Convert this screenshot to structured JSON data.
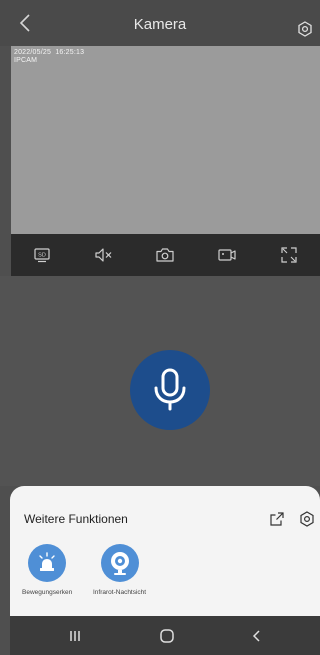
{
  "header": {
    "title": "Kamera",
    "back_icon": "chevron-left-icon",
    "settings_icon": "gear-icon"
  },
  "video": {
    "timestamp": "2022/05/25  16:25:13",
    "camera_name": "IPCAM"
  },
  "toolbar": {
    "items": [
      {
        "icon": "sd-quality-icon",
        "label": "SD"
      },
      {
        "icon": "mute-icon"
      },
      {
        "icon": "camera-snapshot-icon"
      },
      {
        "icon": "video-record-icon"
      },
      {
        "icon": "fullscreen-icon"
      }
    ]
  },
  "talk": {
    "icon": "microphone-icon",
    "color": "#1d4d8c"
  },
  "more_functions": {
    "title": "Weitere Funktionen",
    "open_icon": "external-link-icon",
    "settings_icon": "gear-icon",
    "features": [
      {
        "label": "Bewegungserken",
        "icon": "siren-icon"
      },
      {
        "label": "Infrarot-Nachtsicht",
        "icon": "ir-camera-icon"
      }
    ],
    "accent_color": "#4f8fd6"
  },
  "navigation": {
    "recent_icon": "recent-apps-icon",
    "home_icon": "home-icon",
    "back_icon": "back-icon"
  }
}
